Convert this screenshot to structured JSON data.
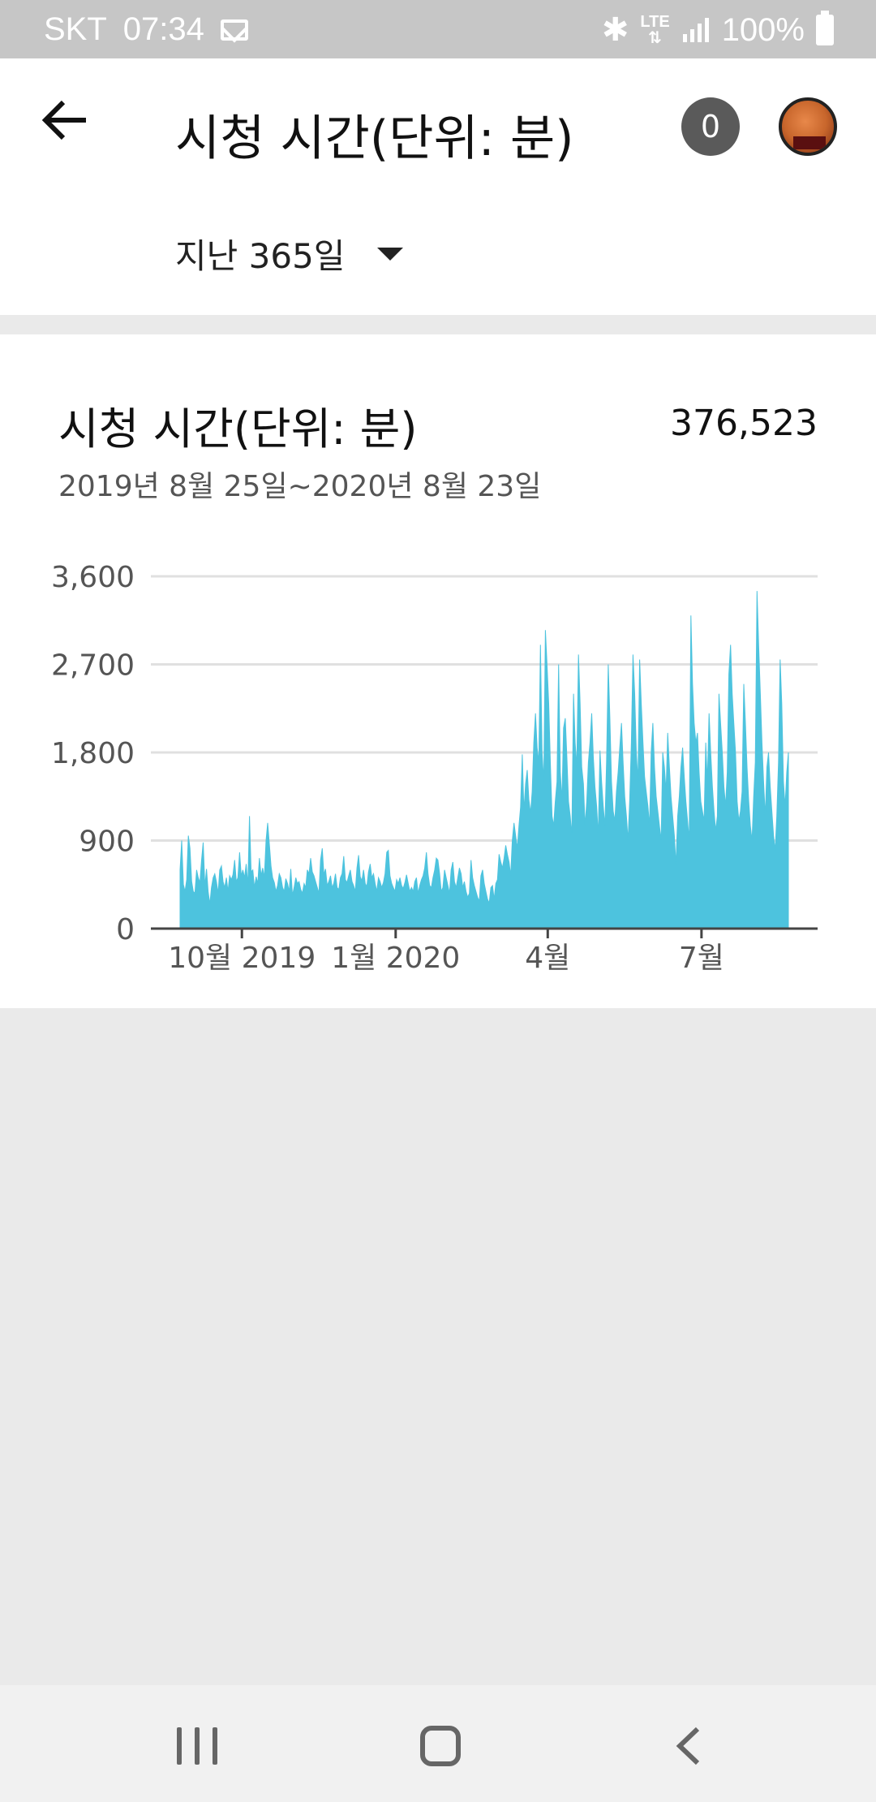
{
  "status_bar": {
    "carrier": "SKT",
    "time": "07:34",
    "network": "LTE",
    "battery": "100%"
  },
  "header": {
    "title": "시청 시간(단위: 분)",
    "notification_count": "0",
    "range_label": "지난 365일"
  },
  "card": {
    "title": "시청 시간(단위: 분)",
    "total": "376,523",
    "date_range": "2019년 8월 25일~2020년 8월 23일"
  },
  "colors": {
    "area": "#4dc3de",
    "grid": "#e0e0e0",
    "axis": "#444444"
  },
  "chart_data": {
    "type": "area",
    "ylim": [
      0,
      3600
    ],
    "yticks": [
      "0",
      "900",
      "1,800",
      "2,700",
      "3,600"
    ],
    "xticks": [
      "10월 2019",
      "1월 2020",
      "4월",
      "7월"
    ],
    "xtick_days": [
      37,
      129,
      220,
      312
    ],
    "days": 365,
    "values": [
      600,
      900,
      450,
      380,
      500,
      950,
      820,
      480,
      380,
      360,
      600,
      520,
      470,
      700,
      880,
      430,
      610,
      380,
      250,
      420,
      520,
      560,
      480,
      360,
      600,
      640,
      480,
      420,
      520,
      380,
      540,
      500,
      550,
      700,
      480,
      520,
      780,
      540,
      600,
      520,
      660,
      440,
      1150,
      580,
      600,
      420,
      530,
      460,
      720,
      540,
      620,
      520,
      900,
      1080,
      860,
      640,
      520,
      470,
      380,
      440,
      560,
      520,
      420,
      380,
      510,
      460,
      380,
      610,
      340,
      420,
      520,
      460,
      480,
      400,
      360,
      460,
      420,
      600,
      560,
      720,
      580,
      540,
      480,
      420,
      360,
      700,
      820,
      550,
      610,
      440,
      480,
      540,
      420,
      460,
      560,
      420,
      400,
      520,
      560,
      740,
      500,
      470,
      540,
      600,
      480,
      440,
      380,
      620,
      750,
      530,
      490,
      600,
      460,
      430,
      580,
      660,
      520,
      560,
      460,
      380,
      520,
      480,
      420,
      470,
      560,
      780,
      800,
      540,
      460,
      420,
      380,
      500,
      460,
      520,
      440,
      410,
      470,
      550,
      460,
      380,
      420,
      380,
      480,
      520,
      360,
      440,
      500,
      540,
      620,
      780,
      560,
      440,
      420,
      520,
      600,
      720,
      700,
      560,
      380,
      420,
      600,
      520,
      440,
      360,
      600,
      680,
      480,
      420,
      520,
      620,
      560,
      420,
      480,
      380,
      320,
      360,
      700,
      520,
      440,
      380,
      320,
      280,
      540,
      600,
      460,
      380,
      300,
      260,
      420,
      440,
      300,
      460,
      500,
      760,
      680,
      620,
      720,
      850,
      760,
      680,
      540,
      900,
      1080,
      950,
      820,
      1050,
      1240,
      1780,
      1200,
      1480,
      1620,
      1320,
      1180,
      1400,
      1900,
      2200,
      1850,
      1700,
      2900,
      1800,
      1500,
      3050,
      2700,
      2300,
      1700,
      1150,
      1050,
      1300,
      1500,
      2700,
      1600,
      1300,
      2050,
      2150,
      1750,
      1300,
      1150,
      950,
      2400,
      1900,
      1650,
      2800,
      2300,
      1650,
      1480,
      1050,
      1300,
      1700,
      1900,
      2200,
      1750,
      1450,
      1250,
      950,
      1820,
      1500,
      1250,
      1050,
      1700,
      2700,
      2150,
      1500,
      1200,
      1100,
      1400,
      1600,
      1850,
      2100,
      1700,
      1350,
      1150,
      900,
      1300,
      1900,
      2800,
      2400,
      1800,
      1500,
      2750,
      2300,
      1900,
      1550,
      1400,
      1250,
      1050,
      1800,
      2100,
      1650,
      1350,
      1200,
      1050,
      900,
      1800,
      1650,
      1400,
      2000,
      1650,
      1350,
      1150,
      950,
      650,
      1150,
      1350,
      1650,
      1850,
      1550,
      1300,
      1100,
      900,
      3200,
      2500,
      2100,
      1900,
      2000,
      1600,
      1300,
      1200,
      1100,
      1900,
      1500,
      2200,
      1800,
      1450,
      1200,
      1000,
      1150,
      2400,
      2100,
      1800,
      1450,
      1250,
      1600,
      2600,
      2900,
      2400,
      2100,
      1800,
      1300,
      1100,
      1200,
      1400,
      2500,
      2100,
      1650,
      1300,
      1050,
      900,
      1350,
      1700,
      3450,
      2900,
      2400,
      1900,
      1500,
      1150,
      1650,
      1800,
      1450,
      1200,
      950,
      800,
      1150,
      1700,
      2750,
      2300,
      1500,
      1250,
      1600,
      1800
    ]
  }
}
